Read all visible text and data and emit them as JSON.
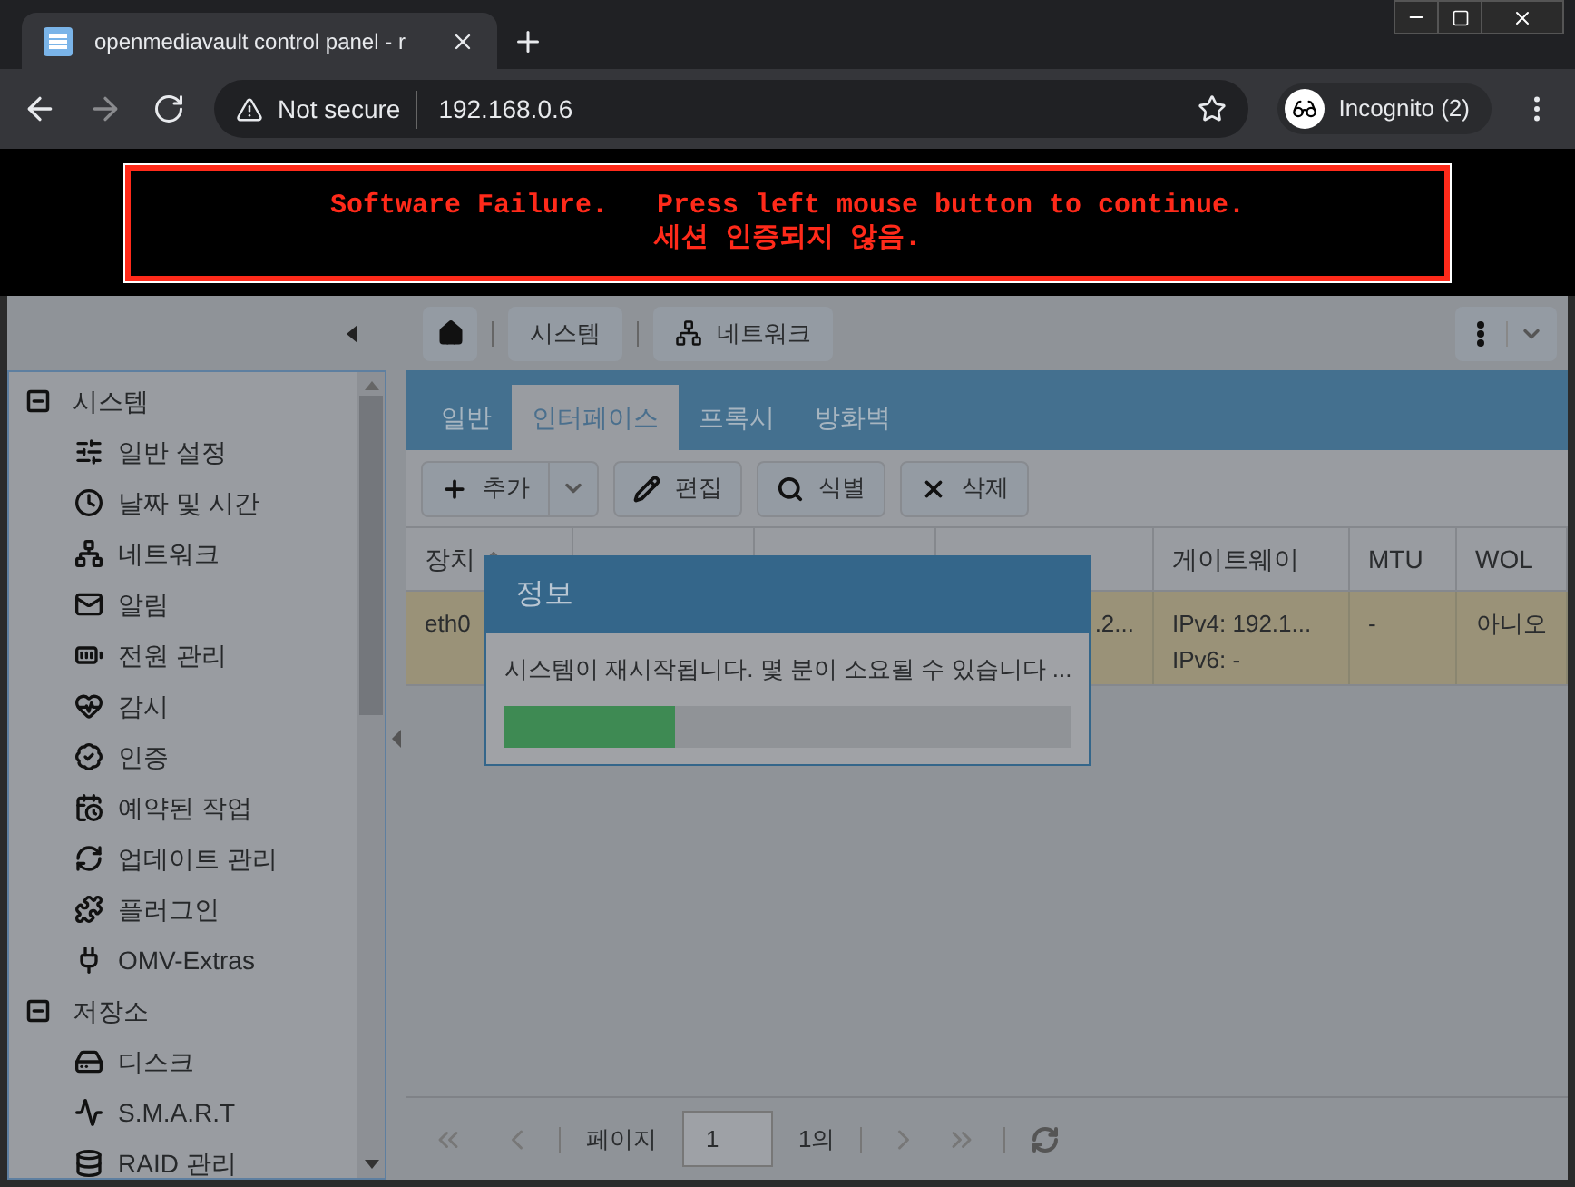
{
  "browser": {
    "tab_title": "openmediavault control panel - r",
    "security": "Not secure",
    "url": "192.168.0.6",
    "profile": "Incognito (2)"
  },
  "banner": {
    "line_1": "Software Failure.   Press left mouse button to continue.",
    "line_2": "세션 인증되지 않음."
  },
  "breadcrumb": [
    "시스템",
    "네트워크"
  ],
  "sidebar": {
    "groups": [
      {
        "label": "시스템",
        "expanded": true,
        "children": [
          {
            "label": "일반 설정"
          },
          {
            "label": "날짜 및 시간"
          },
          {
            "label": "네트워크"
          },
          {
            "label": "알림"
          },
          {
            "label": "전원 관리"
          },
          {
            "label": "감시"
          },
          {
            "label": "인증"
          },
          {
            "label": "예약된 작업"
          },
          {
            "label": "업데이트 관리"
          },
          {
            "label": "플러그인"
          },
          {
            "label": "OMV-Extras"
          }
        ]
      },
      {
        "label": "저장소",
        "expanded": true,
        "children": [
          {
            "label": "디스크"
          },
          {
            "label": "S.M.A.R.T"
          },
          {
            "label": "RAID 관리"
          }
        ]
      }
    ]
  },
  "tabs": [
    {
      "label": "일반",
      "selected": false
    },
    {
      "label": "인터페이스",
      "selected": true
    },
    {
      "label": "프록시",
      "selected": false
    },
    {
      "label": "방화벽",
      "selected": false
    }
  ],
  "toolbar": [
    "추가",
    "편집",
    "식별",
    "삭제"
  ],
  "table": {
    "columns": [
      "장치",
      "",
      "",
      "",
      "게이트웨이",
      "MTU",
      "WOL"
    ],
    "rows": [
      {
        "selected": true,
        "cells": [
          "eth0",
          "",
          "",
          ".2...",
          "IPv4: 192.1...\nIPv6: -",
          "-",
          "아니오"
        ]
      }
    ]
  },
  "paging": {
    "label": "페이지",
    "page": "1",
    "of": "1의"
  },
  "dialog": {
    "title": "정보",
    "message": "시스템이 재시작됩니다. 몇 분이 소요될 수 있습니다 ...",
    "level": 0.3
  }
}
